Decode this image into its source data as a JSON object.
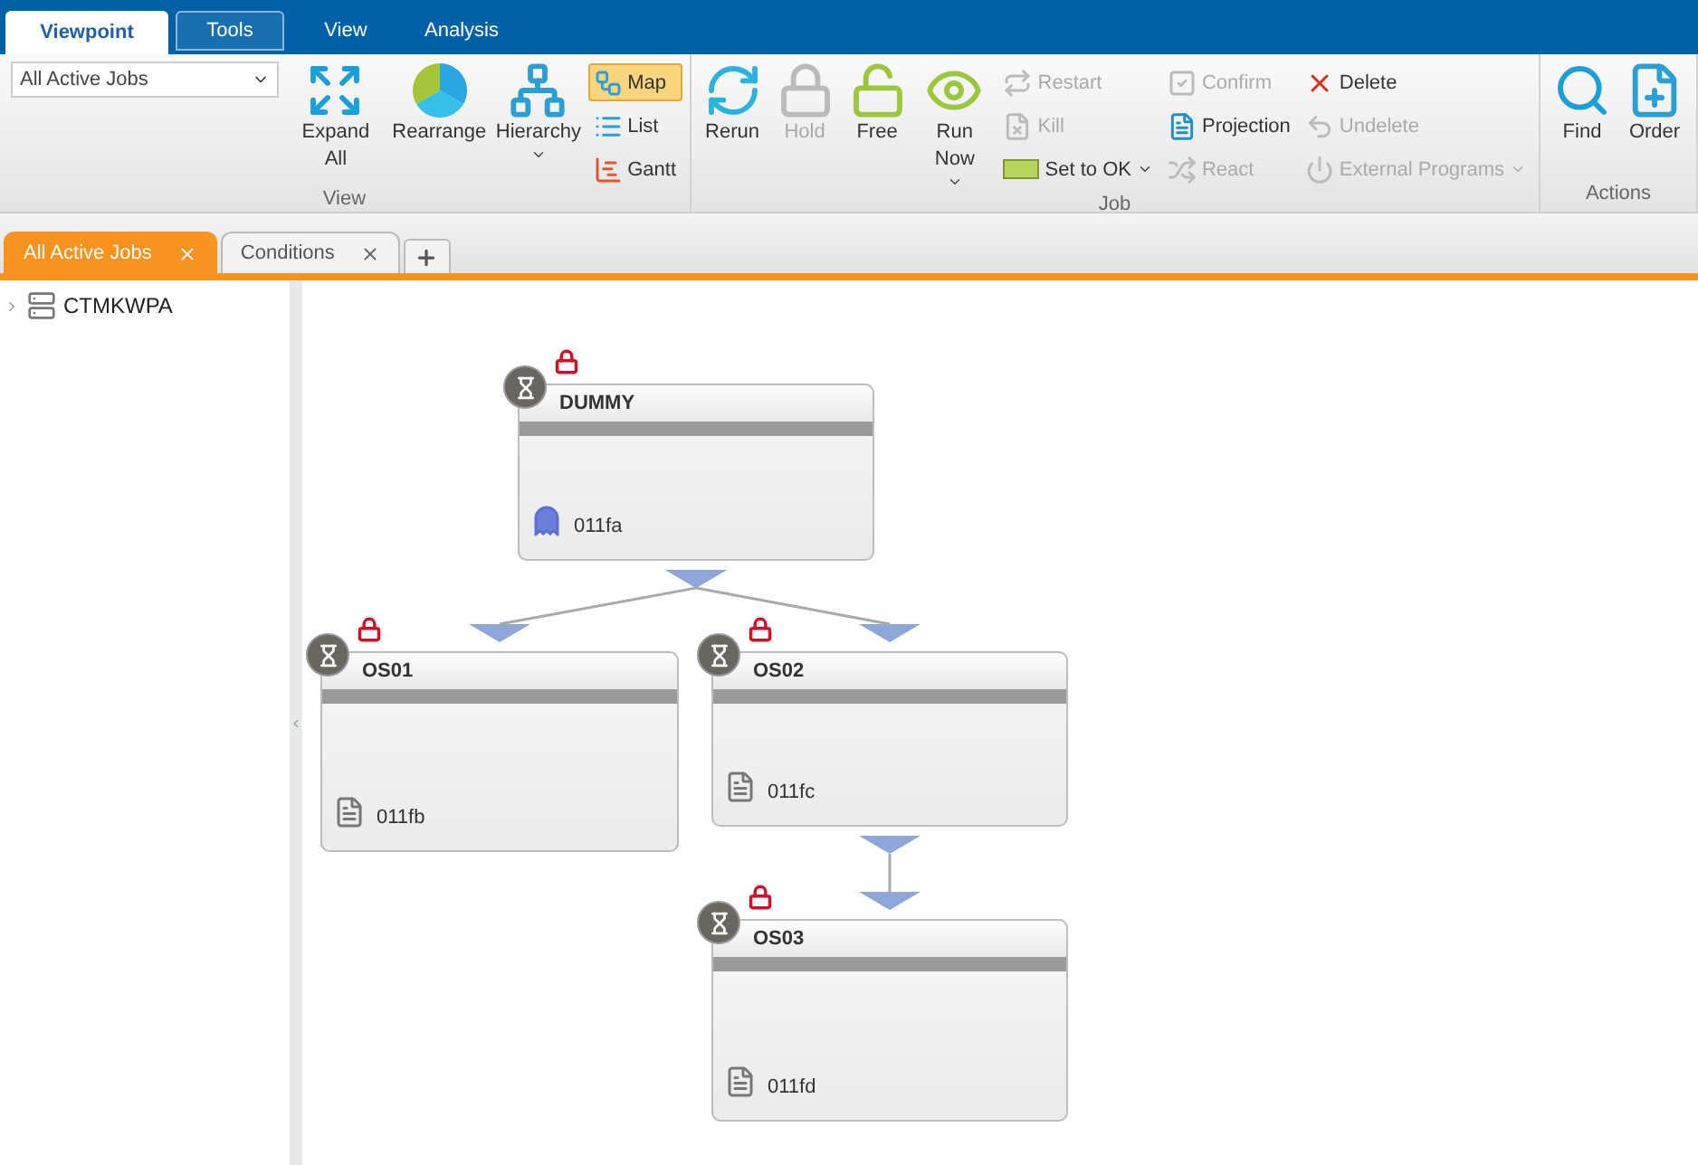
{
  "menu_tabs": [
    {
      "label": "Viewpoint",
      "selected": true,
      "highlighted": false
    },
    {
      "label": "Tools",
      "selected": false,
      "highlighted": true
    },
    {
      "label": "View",
      "selected": false,
      "highlighted": false
    },
    {
      "label": "Analysis",
      "selected": false,
      "highlighted": false
    }
  ],
  "viewpoint_select": {
    "value": "All Active Jobs"
  },
  "ribbon_groups": [
    {
      "label": "View",
      "columns": [
        {
          "kind": "large",
          "items": [
            {
              "label": "Expand All",
              "disabled": false,
              "dropdown": false
            }
          ]
        },
        {
          "kind": "large",
          "items": [
            {
              "label": "Rearrange",
              "disabled": false,
              "dropdown": false
            }
          ]
        },
        {
          "kind": "large",
          "items": [
            {
              "label": "Hierarchy",
              "disabled": false,
              "dropdown": true
            }
          ]
        },
        {
          "kind": "small",
          "items": [
            {
              "label": "Map",
              "disabled": false,
              "dropdown": false,
              "selected": true
            },
            {
              "label": "List",
              "disabled": false,
              "dropdown": false,
              "selected": false
            },
            {
              "label": "Gantt",
              "disabled": false,
              "dropdown": false,
              "selected": false
            }
          ]
        }
      ]
    },
    {
      "label": "Job",
      "columns": [
        {
          "kind": "large",
          "items": [
            {
              "label": "Rerun",
              "disabled": false,
              "dropdown": false
            }
          ]
        },
        {
          "kind": "large",
          "items": [
            {
              "label": "Hold",
              "disabled": true,
              "dropdown": false
            }
          ]
        },
        {
          "kind": "large",
          "items": [
            {
              "label": "Free",
              "disabled": false,
              "dropdown": false
            }
          ]
        },
        {
          "kind": "large",
          "items": [
            {
              "label": "Run Now",
              "disabled": false,
              "dropdown": true
            }
          ]
        },
        {
          "kind": "small",
          "items": [
            {
              "label": "Restart",
              "disabled": true,
              "dropdown": false,
              "selected": false
            },
            {
              "label": "Kill",
              "disabled": true,
              "dropdown": false,
              "selected": false
            },
            {
              "label": "Set to OK",
              "disabled": false,
              "dropdown": true,
              "selected": false
            }
          ]
        },
        {
          "kind": "small",
          "items": [
            {
              "label": "Confirm",
              "disabled": true,
              "dropdown": false,
              "selected": false
            },
            {
              "label": "Projection",
              "disabled": false,
              "dropdown": false,
              "selected": false
            },
            {
              "label": "React",
              "disabled": true,
              "dropdown": false,
              "selected": false
            }
          ]
        },
        {
          "kind": "small",
          "items": [
            {
              "label": "Delete",
              "disabled": false,
              "dropdown": false,
              "selected": false
            },
            {
              "label": "Undelete",
              "disabled": true,
              "dropdown": false,
              "selected": false
            },
            {
              "label": "External Programs",
              "disabled": true,
              "dropdown": true,
              "selected": false
            }
          ]
        }
      ]
    },
    {
      "label": "Actions",
      "columns": [
        {
          "kind": "large",
          "items": [
            {
              "label": "Find",
              "disabled": false,
              "dropdown": false
            }
          ]
        },
        {
          "kind": "large",
          "items": [
            {
              "label": "Order",
              "disabled": false,
              "dropdown": false
            }
          ]
        }
      ]
    }
  ],
  "doc_tabs": [
    {
      "label": "All Active Jobs",
      "selected": true
    },
    {
      "label": "Conditions",
      "selected": false
    }
  ],
  "tree": [
    {
      "label": "CTMKWPA",
      "expanded": false
    }
  ],
  "jobs": [
    {
      "name": "DUMMY",
      "kind": "dummy",
      "id": "011fa",
      "locked": true
    },
    {
      "name": "OS01",
      "kind": "file",
      "id": "011fb",
      "locked": true
    },
    {
      "name": "OS02",
      "kind": "file",
      "id": "011fc",
      "locked": true
    },
    {
      "name": "OS03",
      "kind": "file",
      "id": "011fd",
      "locked": true
    }
  ]
}
